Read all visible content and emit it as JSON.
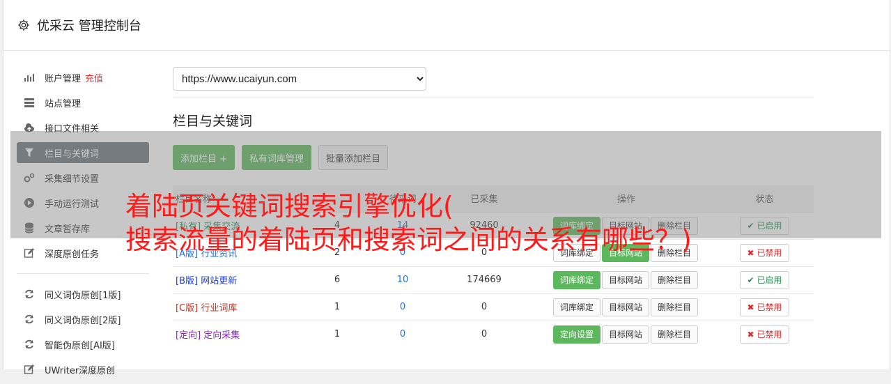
{
  "header": {
    "title": "优采云 管理控制台",
    "icon": "gear-icon"
  },
  "sidebar": {
    "items": [
      {
        "label": "账户管理",
        "extra": "充值",
        "icon": "bar-chart-icon"
      },
      {
        "label": "站点管理",
        "icon": "server-icon"
      },
      {
        "label": "接口文件相关",
        "icon": "cloud-upload-icon"
      },
      {
        "label": "栏目与关键词",
        "icon": "filter-icon",
        "active": true
      },
      {
        "label": "采集细节设置",
        "icon": "gears-icon"
      },
      {
        "label": "手动运行测试",
        "icon": "play-circle-icon"
      },
      {
        "label": "文章暂存库",
        "icon": "database-icon"
      },
      {
        "label": "深度原创任务",
        "icon": "edit-icon"
      }
    ],
    "tools": [
      {
        "label": "同义词伪原创[1版]",
        "icon": "refresh-icon"
      },
      {
        "label": "同义词伪原创[2版]",
        "icon": "refresh-icon"
      },
      {
        "label": "智能伪原创[AI版]",
        "icon": "refresh-icon"
      },
      {
        "label": "UWriter深度原创",
        "icon": "edit-icon"
      }
    ]
  },
  "main": {
    "site_select": "https://www.ucaiyun.com",
    "section_title": "栏目与关键词",
    "buttons": {
      "add_column": "添加栏目 +",
      "private_lexicon": "私有词库管理",
      "batch_add": "批量添加栏目"
    },
    "table": {
      "headers": {
        "name": "栏目名称",
        "col2": "",
        "col3": "待采词",
        "col4": "已采集",
        "ops": "操作",
        "status": "状态"
      },
      "rows": [
        {
          "tag": "[私有]",
          "name": "采集交流",
          "c2": "4",
          "c3": "14",
          "c4": "92460",
          "op1": "词库绑定",
          "op2": "目标网站",
          "op3": "删除栏目",
          "status": "已启用"
        },
        {
          "tag": "[A版]",
          "name": "行业资讯",
          "c2": "2",
          "c3": "0",
          "c4": "0",
          "op1": "词库绑定",
          "op2": "目标网站",
          "op3": "删除栏目",
          "status": "已禁用"
        },
        {
          "tag": "[B版]",
          "name": "网站更新",
          "c2": "6",
          "c3": "10",
          "c4": "174669",
          "op1": "词库绑定",
          "op2": "目标网站",
          "op3": "删除栏目",
          "status": "已启用"
        },
        {
          "tag": "[C版]",
          "name": "行业词库",
          "c2": "1",
          "c3": "0",
          "c4": "0",
          "op1": "词库绑定",
          "op2": "目标网站",
          "op3": "删除栏目",
          "status": "已禁用"
        },
        {
          "tag": "[定向]",
          "name": "定向采集",
          "c2": "1",
          "c3": "0",
          "c4": "0",
          "op1": "定向设置",
          "op2": "目标网站",
          "op3": "删除栏目",
          "status": "已禁用"
        }
      ]
    }
  },
  "overlay": {
    "line1": "着陆页关键词搜索引擎优化(",
    "line2": "搜索流量的着陆页和搜索词之间的关系有哪些？)"
  },
  "colors": {
    "accent": "#5cb85c",
    "active_nav": "#6c757d",
    "overlay_text": "#ff1a1a"
  }
}
